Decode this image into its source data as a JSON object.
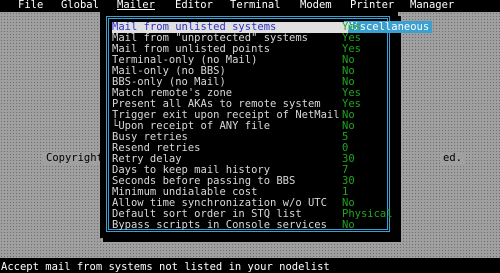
{
  "menubar": {
    "items": [
      "File",
      "Global",
      "Mailer",
      "Editor",
      "Terminal",
      "Modem",
      "Printer",
      "Manager"
    ]
  },
  "background": {
    "copyright_left": "Copyright",
    "copyright_right": "ed."
  },
  "window": {
    "title": "Miscellaneous",
    "rows": [
      {
        "label": "Mail from unlisted systems",
        "value": "Yes"
      },
      {
        "label": "Mail from \"unprotected\" systems",
        "value": "Yes"
      },
      {
        "label": "Mail from unlisted points",
        "value": "Yes"
      },
      {
        "label": "Terminal-only (no Mail)",
        "value": "No"
      },
      {
        "label": "Mail-only (no BBS)",
        "value": "No"
      },
      {
        "label": "BBS-only (no Mail)",
        "value": "No"
      },
      {
        "label": "Match remote's zone",
        "value": "Yes"
      },
      {
        "label": "Present all AKAs to remote system",
        "value": "Yes"
      },
      {
        "label": "Trigger exit upon receipt of NetMail",
        "value": "No"
      },
      {
        "label": "└Upon receipt of ANY file",
        "value": "No"
      },
      {
        "label": "Busy retries",
        "value": "5"
      },
      {
        "label": "Resend retries",
        "value": "0"
      },
      {
        "label": "Retry delay",
        "value": "30"
      },
      {
        "label": "Days to keep mail history",
        "value": "7"
      },
      {
        "label": "Seconds before passing to BBS",
        "value": "30"
      },
      {
        "label": "Minimum undialable cost",
        "value": "1"
      },
      {
        "label": "Allow time synchronization w/o UTC",
        "value": "No"
      },
      {
        "label": "Default sort order in STQ list",
        "value": "Physical"
      },
      {
        "label": "Bypass scripts in Console services",
        "value": "No"
      }
    ]
  },
  "status_bar": {
    "text": "Accept mail from systems not listed in your nodelist"
  }
}
